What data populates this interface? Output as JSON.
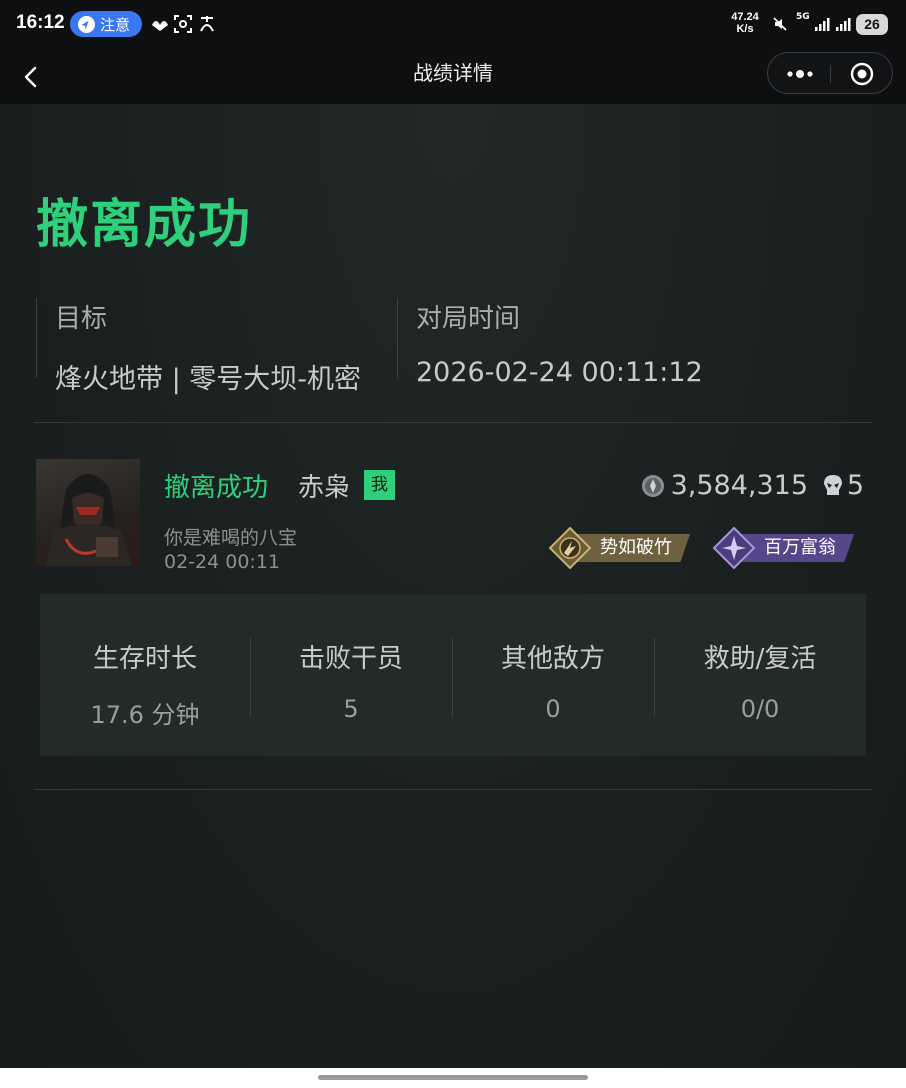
{
  "status_bar": {
    "time": "16:12",
    "notice_label": "注意",
    "net_speed_value": "47.24",
    "net_speed_unit": "K/s",
    "network_type": "5G",
    "battery": "26"
  },
  "nav": {
    "title": "战绩详情"
  },
  "result": {
    "title": "撤离成功",
    "colors": {
      "success": "#2fd07c"
    }
  },
  "info": {
    "target_label": "目标",
    "target_value": "烽火地带 | 零号大坝-机密",
    "time_label": "对局时间",
    "time_value": "2026-02-24 00:11:12"
  },
  "player": {
    "status": "撤离成功",
    "name": "赤枭",
    "me_badge": "我",
    "team": "你是难喝的八宝",
    "time": "02-24 00:11",
    "money": "3,584,315",
    "kills": "5",
    "medals": [
      {
        "label": "势如破竹",
        "color": "#8a7a4e"
      },
      {
        "label": "百万富翁",
        "color": "#5e4e8c"
      }
    ]
  },
  "stats": [
    {
      "label": "生存时长",
      "value": "17.6 分钟"
    },
    {
      "label": "击败干员",
      "value": "5"
    },
    {
      "label": "其他敌方",
      "value": "0"
    },
    {
      "label": "救助/复活",
      "value": "0/0"
    }
  ]
}
